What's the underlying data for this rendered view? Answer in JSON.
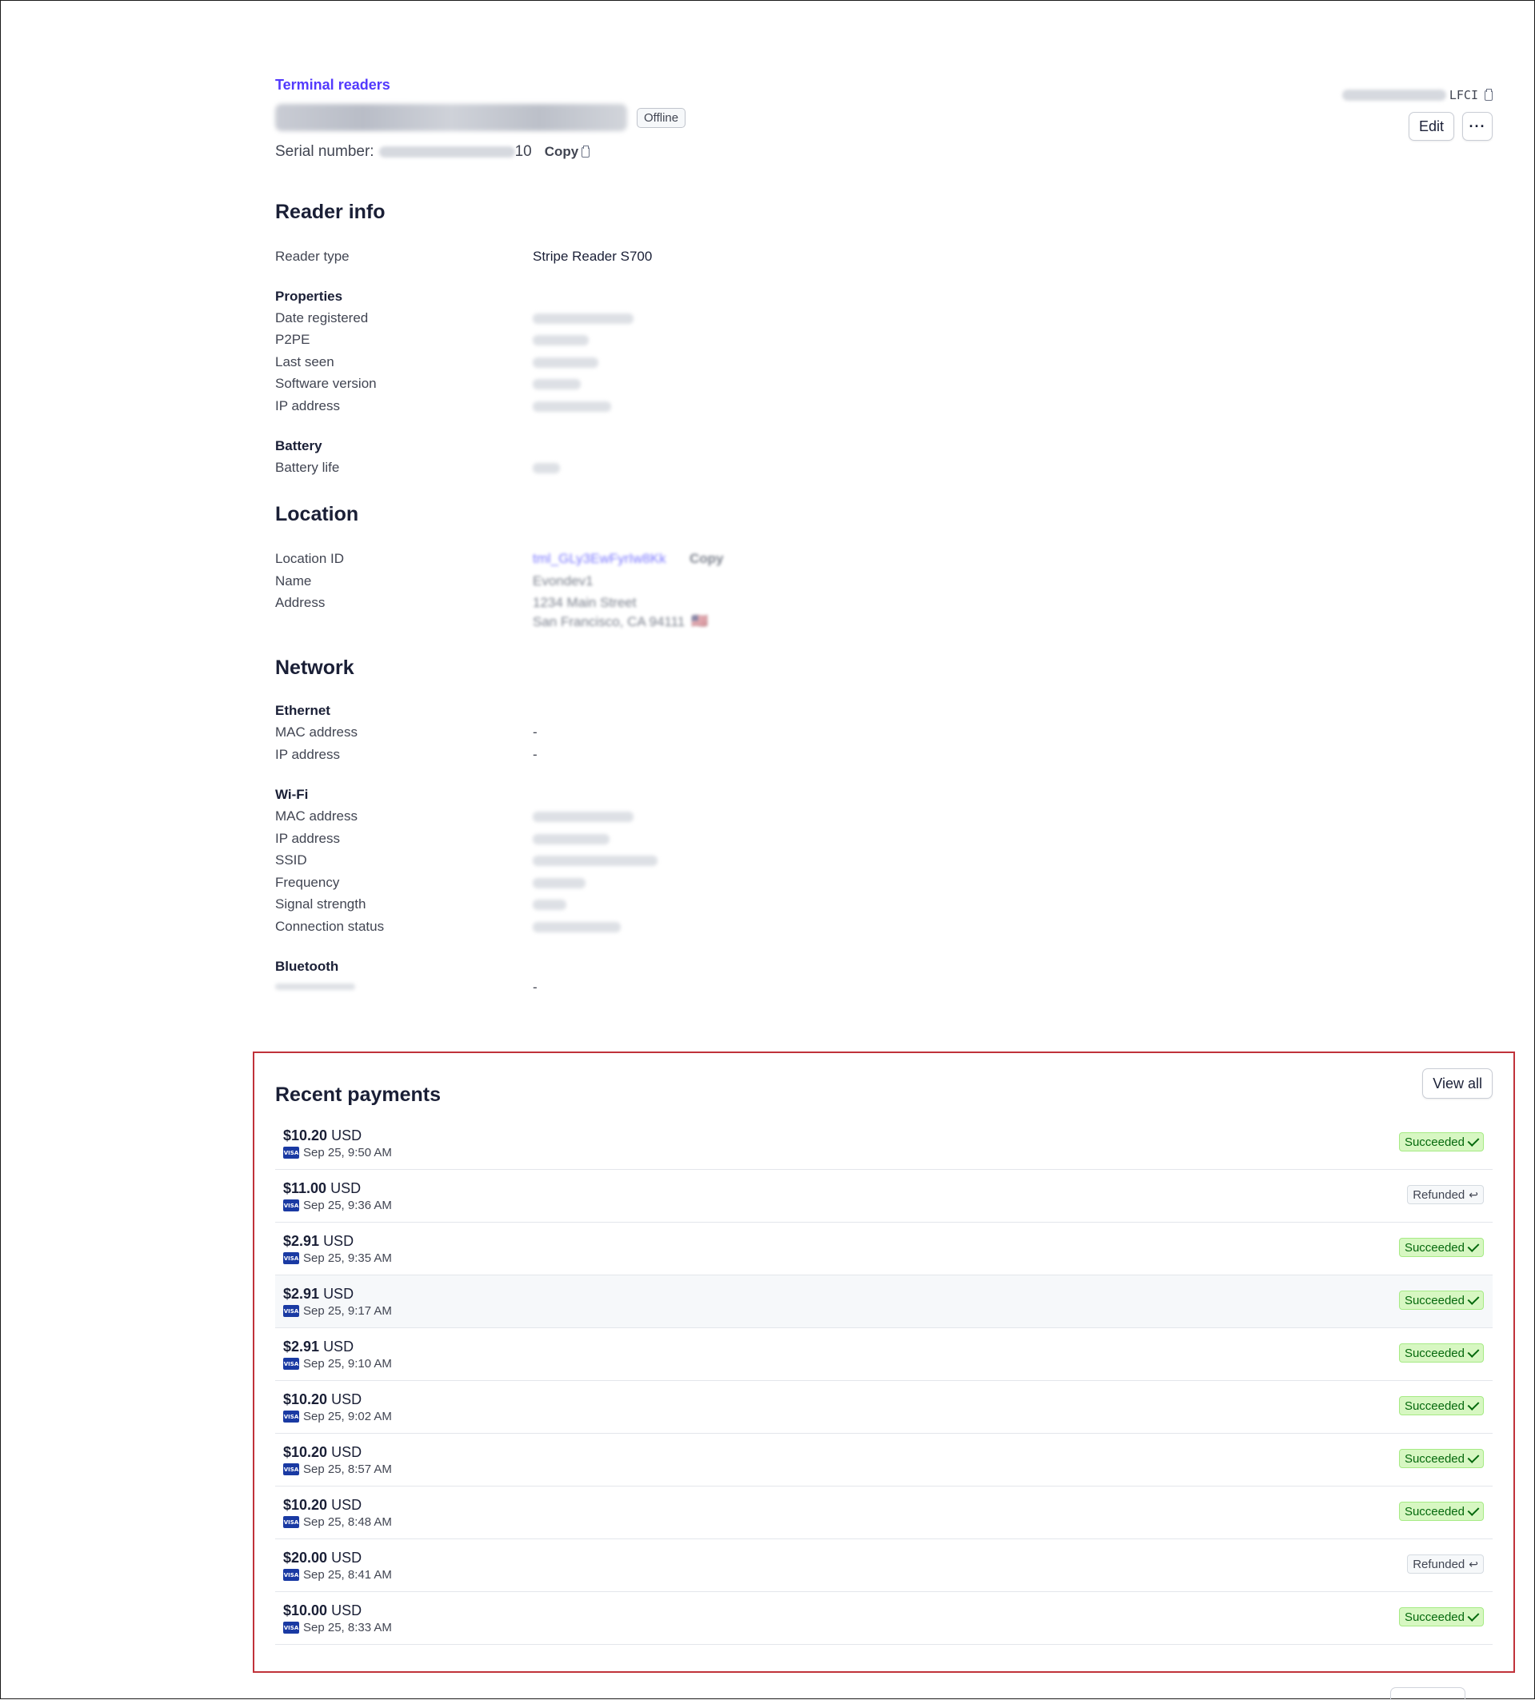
{
  "header": {
    "breadcrumb": "Terminal readers",
    "status_badge": "Offline",
    "serial_label": "Serial number:",
    "serial_suffix": "10",
    "copy_label": "Copy",
    "reader_id_suffix": "LFCI",
    "edit_label": "Edit",
    "more_label": "···"
  },
  "reader_info": {
    "title": "Reader info",
    "reader_type_label": "Reader type",
    "reader_type_value": "Stripe Reader S700",
    "properties_title": "Properties",
    "properties": [
      "Date registered",
      "P2PE",
      "Last seen",
      "Software version",
      "IP address"
    ],
    "battery_title": "Battery",
    "battery_label": "Battery life"
  },
  "location": {
    "title": "Location",
    "id_label": "Location ID",
    "id_value": "tml_GLy3EwFyrIw8Kk",
    "copy_label": "Copy",
    "name_label": "Name",
    "name_value": "Evondev1",
    "address_label": "Address",
    "address_line1": "1234 Main Street",
    "address_line2": "San Francisco, CA 94111",
    "flag": "🇺🇸"
  },
  "network": {
    "title": "Network",
    "ethernet_title": "Ethernet",
    "ethernet_mac_label": "MAC address",
    "ethernet_mac_value": "-",
    "ethernet_ip_label": "IP address",
    "ethernet_ip_value": "-",
    "wifi_title": "Wi-Fi",
    "wifi_labels": [
      "MAC address",
      "IP address",
      "SSID",
      "Frequency",
      "Signal strength",
      "Connection status"
    ],
    "bluetooth_title": "Bluetooth",
    "bluetooth_mac_value": "-"
  },
  "recent_payments": {
    "title": "Recent payments",
    "view_all_label": "View all",
    "card_brand": "VISA",
    "currency": "USD",
    "rows": [
      {
        "amount": "$10.20",
        "date": "Sep 25, 9:50 AM",
        "status": "Succeeded"
      },
      {
        "amount": "$11.00",
        "date": "Sep 25, 9:36 AM",
        "status": "Refunded"
      },
      {
        "amount": "$2.91",
        "date": "Sep 25, 9:35 AM",
        "status": "Succeeded"
      },
      {
        "amount": "$2.91",
        "date": "Sep 25, 9:17 AM",
        "status": "Succeeded"
      },
      {
        "amount": "$2.91",
        "date": "Sep 25, 9:10 AM",
        "status": "Succeeded"
      },
      {
        "amount": "$10.20",
        "date": "Sep 25, 9:02 AM",
        "status": "Succeeded"
      },
      {
        "amount": "$10.20",
        "date": "Sep 25, 8:57 AM",
        "status": "Succeeded"
      },
      {
        "amount": "$10.20",
        "date": "Sep 25, 8:48 AM",
        "status": "Succeeded"
      },
      {
        "amount": "$20.00",
        "date": "Sep 25, 8:41 AM",
        "status": "Refunded"
      },
      {
        "amount": "$10.00",
        "date": "Sep 25, 8:33 AM",
        "status": "Succeeded"
      }
    ]
  },
  "colors": {
    "link": "#533afd",
    "succeeded_bg": "#d7f7c2",
    "succeeded_text": "#05690d",
    "highlight_border": "#c0323a"
  }
}
